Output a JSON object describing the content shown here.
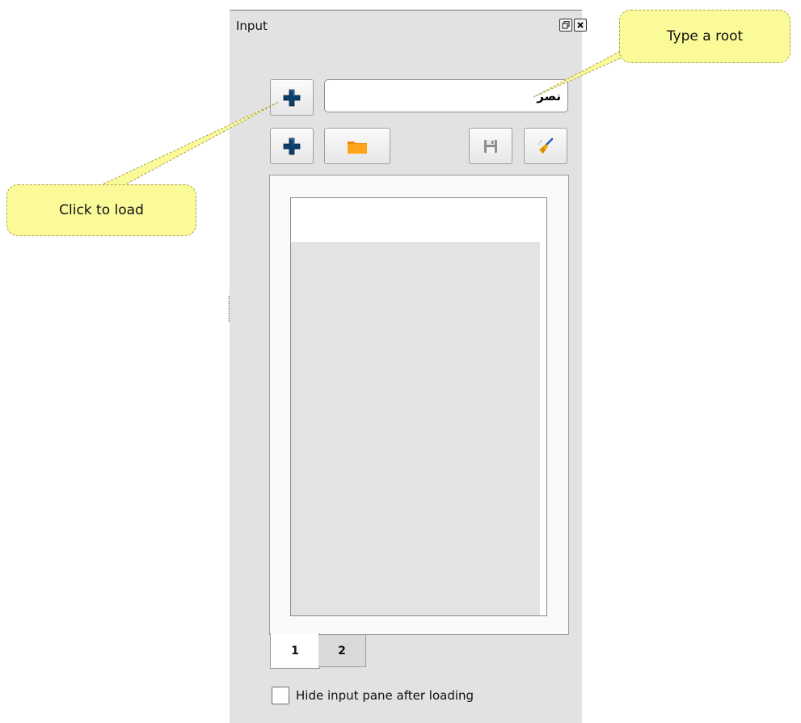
{
  "panel": {
    "title": "Input",
    "title_buttons": [
      "float-icon",
      "close-icon"
    ]
  },
  "toolbar": {
    "add_icon": "plus-icon",
    "open_icon": "folder-icon",
    "save_icon": "floppy-disk-icon",
    "clear_icon": "broom-icon"
  },
  "root_input": {
    "value": "نصر"
  },
  "tabs": [
    {
      "label": "1",
      "active": true
    },
    {
      "label": "2",
      "active": false
    }
  ],
  "options": {
    "hide_after_loading_label": "Hide input pane after loading",
    "hide_after_loading_checked": false
  },
  "callouts": {
    "type_root": "Type a root",
    "click_load": "Click to load"
  },
  "colors": {
    "plus_icon": "#0b3f6e",
    "folder_icon": "#f08a00",
    "callout_fill": "#fbfa99"
  }
}
